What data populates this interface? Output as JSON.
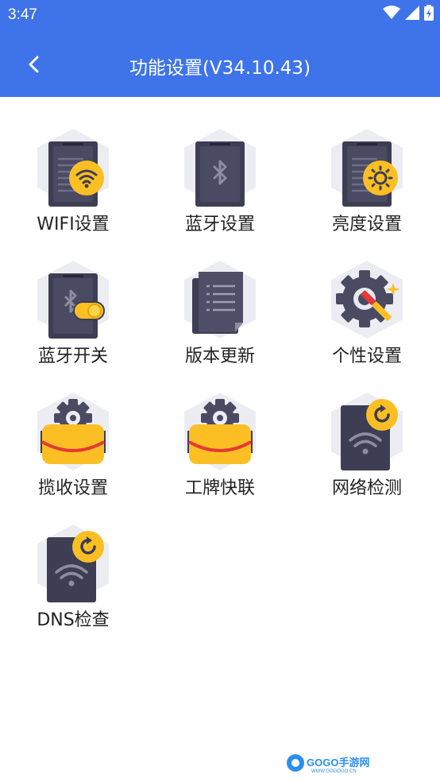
{
  "status_bar": {
    "time": "3:47"
  },
  "header": {
    "title": "功能设置(V34.10.43)"
  },
  "items": [
    {
      "label": "WIFI设置",
      "icon": "wifi-settings-icon"
    },
    {
      "label": "蓝牙设置",
      "icon": "bluetooth-settings-icon"
    },
    {
      "label": "亮度设置",
      "icon": "brightness-settings-icon"
    },
    {
      "label": "蓝牙开关",
      "icon": "bluetooth-toggle-icon"
    },
    {
      "label": "版本更新",
      "icon": "version-update-icon"
    },
    {
      "label": "个性设置",
      "icon": "personalization-icon"
    },
    {
      "label": "揽收设置",
      "icon": "pickup-settings-icon"
    },
    {
      "label": "工牌快联",
      "icon": "badge-quick-connect-icon"
    },
    {
      "label": "网络检测",
      "icon": "network-check-icon"
    },
    {
      "label": "DNS检查",
      "icon": "dns-check-icon"
    }
  ],
  "colors": {
    "header_bg": "#3e73ea",
    "device_dark": "#3d3d54",
    "badge_yellow": "#fbbf24",
    "hexagon_bg": "#ececf3"
  }
}
